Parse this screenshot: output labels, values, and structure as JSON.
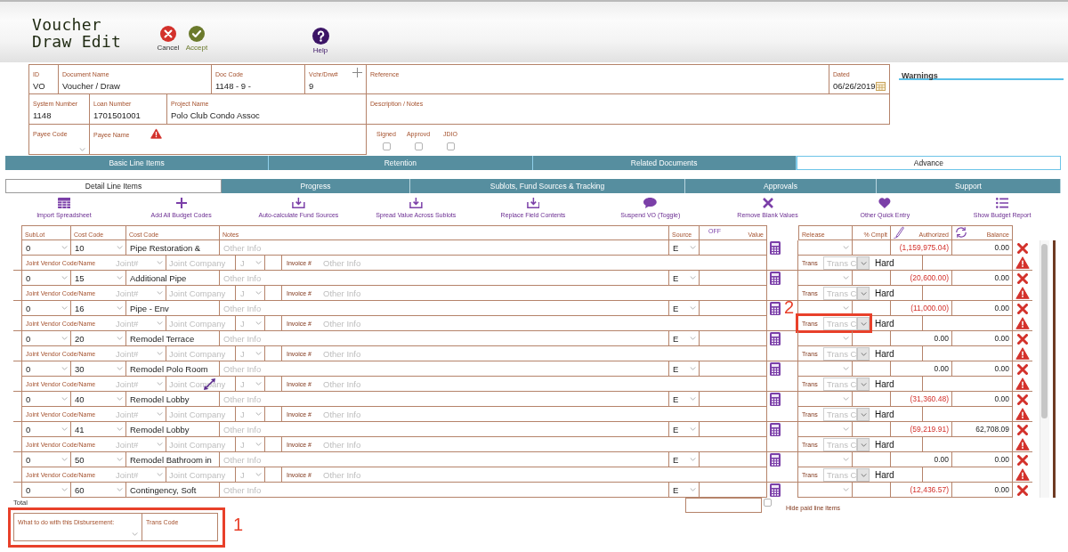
{
  "header": {
    "title": "Voucher Draw Edit",
    "actions": [
      {
        "kind": "cancel",
        "label": "Cancel"
      },
      {
        "kind": "accept",
        "label": "Accept"
      },
      {
        "kind": "help",
        "label": "Help"
      }
    ]
  },
  "form": {
    "rows": [
      {
        "fields": [
          {
            "kind": "text",
            "label": "ID",
            "value": "VO"
          },
          {
            "kind": "text",
            "label": "Document Name",
            "value": "Voucher / Draw"
          },
          {
            "kind": "text",
            "label": "Doc Code",
            "value": "1148 - 9 -"
          },
          {
            "kind": "add",
            "label": "Vchr/Drw#",
            "value": "9"
          },
          {
            "kind": "text",
            "label": "Reference"
          },
          {
            "kind": "date",
            "label": "Dated",
            "value": "06/26/2019"
          }
        ]
      },
      {
        "fields": [
          {
            "kind": "text",
            "label": "System Number",
            "value": "1148"
          },
          {
            "kind": "text",
            "label": "Loan Number",
            "value": "1701501001"
          },
          {
            "kind": "text",
            "label": "Project Name",
            "value": "Polo Club Condo Assoc"
          },
          {
            "kind": "text",
            "label": "Description / Notes"
          }
        ]
      },
      {
        "fields": [
          {
            "kind": "select",
            "label": "Payee Code"
          },
          {
            "kind": "warning",
            "label": "Payee Name"
          }
        ],
        "flags": [
          {
            "label": "Signed",
            "checked": false
          },
          {
            "label": "Approvd",
            "checked": false
          },
          {
            "label": "JDIO",
            "checked": false
          }
        ]
      }
    ]
  },
  "warnings": {
    "title": "Warnings"
  },
  "tabs": [
    {
      "label": "Basic Line Items",
      "selected": false
    },
    {
      "label": "Retention",
      "selected": false
    },
    {
      "label": "Related Documents",
      "selected": false
    },
    {
      "label": "Advance",
      "selected": true
    }
  ],
  "subtabs": [
    {
      "label": "Detail Line Items",
      "selected": true
    },
    {
      "label": "Progress",
      "selected": false
    },
    {
      "label": "Sublots, Fund Sources & Tracking",
      "selected": false
    },
    {
      "label": "Approvals",
      "selected": false
    },
    {
      "label": "Support",
      "selected": false
    }
  ],
  "toolbar": [
    {
      "kind": "grid",
      "label": "Import Spreadsheet"
    },
    {
      "kind": "plus",
      "label": "Add All Budget Codes"
    },
    {
      "kind": "tray",
      "label": "Auto-calculate Fund Sources"
    },
    {
      "kind": "tray",
      "label": "Spread Value Across Sublots"
    },
    {
      "kind": "tray",
      "label": "Replace Field Contents"
    },
    {
      "kind": "comment",
      "label": "Suspend VO (Toggle)"
    },
    {
      "kind": "remove",
      "label": "Remove Blank Values"
    },
    {
      "kind": "heart",
      "label": "Other Quick Entry"
    },
    {
      "kind": "list",
      "label": "Show Budget Report"
    }
  ],
  "table": {
    "columns": [
      {
        "kind": "text",
        "label": "SubLot"
      },
      {
        "kind": "text",
        "label": "Cost Code"
      },
      {
        "kind": "text",
        "label": "Cost Code"
      },
      {
        "kind": "text",
        "label": "Notes"
      },
      {
        "kind": "text",
        "label": "Source"
      },
      {
        "kind": "toggle",
        "label": "Value",
        "toggle": "OFF"
      },
      {
        "kind": "text",
        "label": "Release"
      },
      {
        "kind": "text",
        "label": "% Cmplt"
      },
      {
        "kind": "pen",
        "label": "Authorized"
      },
      {
        "kind": "refresh",
        "label": "Balance"
      }
    ],
    "lines": [
      {
        "sublot": "0",
        "cost_code": "10",
        "description": "Pipe Restoration &",
        "notes_placeholder": "Other Info",
        "source": "E",
        "authorized": "(1,159,975.04)",
        "negative": true,
        "balance": "0.00",
        "detail": {
          "label": "Joint Vendor Code/Name",
          "joint_placeholder": "Joint#",
          "company_placeholder": "Joint Company",
          "j_placeholder": "J",
          "invoice_label": "Invoice #",
          "invoice_placeholder": "Other Info",
          "trans_label": "Trans",
          "trans_placeholder": "Trans C",
          "cost_type": "Hard",
          "cursor": false
        }
      },
      {
        "sublot": "0",
        "cost_code": "15",
        "description": "Additional Pipe",
        "notes_placeholder": "Other Info",
        "source": "E",
        "authorized": "(20,600.00)",
        "negative": true,
        "balance": "0.00",
        "detail": {
          "label": "Joint Vendor Code/Name",
          "joint_placeholder": "Joint#",
          "company_placeholder": "Joint Company",
          "j_placeholder": "J",
          "invoice_label": "Invoice #",
          "invoice_placeholder": "Other Info",
          "trans_label": "Trans",
          "trans_placeholder": "Trans C",
          "cost_type": "Hard",
          "cursor": false
        }
      },
      {
        "sublot": "0",
        "cost_code": "16",
        "description": "Pipe - Env",
        "notes_placeholder": "Other Info",
        "source": "E",
        "authorized": "(11,000.00)",
        "negative": true,
        "balance": "0.00",
        "detail": {
          "label": "Joint Vendor Code/Name",
          "joint_placeholder": "Joint#",
          "company_placeholder": "Joint Company",
          "j_placeholder": "J",
          "invoice_label": "Invoice #",
          "invoice_placeholder": "Other Info",
          "trans_label": "Trans",
          "trans_placeholder": "Trans C",
          "cost_type": "Hard",
          "cursor": false,
          "callout": "2"
        }
      },
      {
        "sublot": "0",
        "cost_code": "20",
        "description": "Remodel Terrace",
        "notes_placeholder": "Other Info",
        "source": "E",
        "authorized": "0.00",
        "negative": false,
        "balance": "0.00",
        "detail": {
          "label": "Joint Vendor Code/Name",
          "joint_placeholder": "Joint#",
          "company_placeholder": "Joint Company",
          "j_placeholder": "J",
          "invoice_label": "Invoice #",
          "invoice_placeholder": "Other Info",
          "trans_label": "Trans",
          "trans_placeholder": "Trans C",
          "cost_type": "Hard",
          "cursor": false
        }
      },
      {
        "sublot": "0",
        "cost_code": "30",
        "description": "Remodel Polo Room",
        "notes_placeholder": "Other Info",
        "source": "E",
        "authorized": "0.00",
        "negative": false,
        "balance": "0.00",
        "detail": {
          "label": "Joint Vendor Code/Name",
          "joint_placeholder": "Joint#",
          "company_placeholder": "Joint Company",
          "j_placeholder": "J",
          "invoice_label": "Invoice #",
          "invoice_placeholder": "Other Info",
          "trans_label": "Trans",
          "trans_placeholder": "Trans C",
          "cost_type": "Hard",
          "cursor": true
        }
      },
      {
        "sublot": "0",
        "cost_code": "40",
        "description": "Remodel Lobby",
        "notes_placeholder": "Other Info",
        "source": "E",
        "authorized": "(31,360.48)",
        "negative": true,
        "balance": "0.00",
        "detail": {
          "label": "Joint Vendor Code/Name",
          "joint_placeholder": "Joint#",
          "company_placeholder": "Joint Company",
          "j_placeholder": "J",
          "invoice_label": "Invoice #",
          "invoice_placeholder": "Other Info",
          "trans_label": "Trans",
          "trans_placeholder": "Trans C",
          "cost_type": "Hard",
          "cursor": false
        }
      },
      {
        "sublot": "0",
        "cost_code": "41",
        "description": "Remodel Lobby",
        "notes_placeholder": "Other Info",
        "source": "E",
        "authorized": "(59,219.91)",
        "negative": true,
        "balance": "62,708.09",
        "detail": {
          "label": "Joint Vendor Code/Name",
          "joint_placeholder": "Joint#",
          "company_placeholder": "Joint Company",
          "j_placeholder": "J",
          "invoice_label": "Invoice #",
          "invoice_placeholder": "Other Info",
          "trans_label": "Trans",
          "trans_placeholder": "Trans C",
          "cost_type": "Hard",
          "cursor": false
        }
      },
      {
        "sublot": "0",
        "cost_code": "50",
        "description": "Remodel Bathroom in",
        "notes_placeholder": "Other Info",
        "source": "E",
        "authorized": "0.00",
        "negative": false,
        "balance": "0.00",
        "detail": {
          "label": "Joint Vendor Code/Name",
          "joint_placeholder": "Joint#",
          "company_placeholder": "Joint Company",
          "j_placeholder": "J",
          "invoice_label": "Invoice #",
          "invoice_placeholder": "Other Info",
          "trans_label": "Trans",
          "trans_placeholder": "Trans C",
          "cost_type": "Hard",
          "cursor": false
        }
      },
      {
        "sublot": "0",
        "cost_code": "60",
        "description": "Contingency, Soft",
        "notes_placeholder": "Other Info",
        "source": "E",
        "authorized": "(12,436.57)",
        "negative": true,
        "balance": "0.00"
      }
    ]
  },
  "totals": {
    "label": "Total",
    "hide_paid": {
      "label": "Hide paid line items",
      "checked": false
    }
  },
  "footer": {
    "callout": "1",
    "fields": [
      {
        "kind": "select",
        "label": "What to do with this Disbursement:"
      },
      {
        "kind": "text",
        "label": "Trans Code"
      }
    ]
  }
}
